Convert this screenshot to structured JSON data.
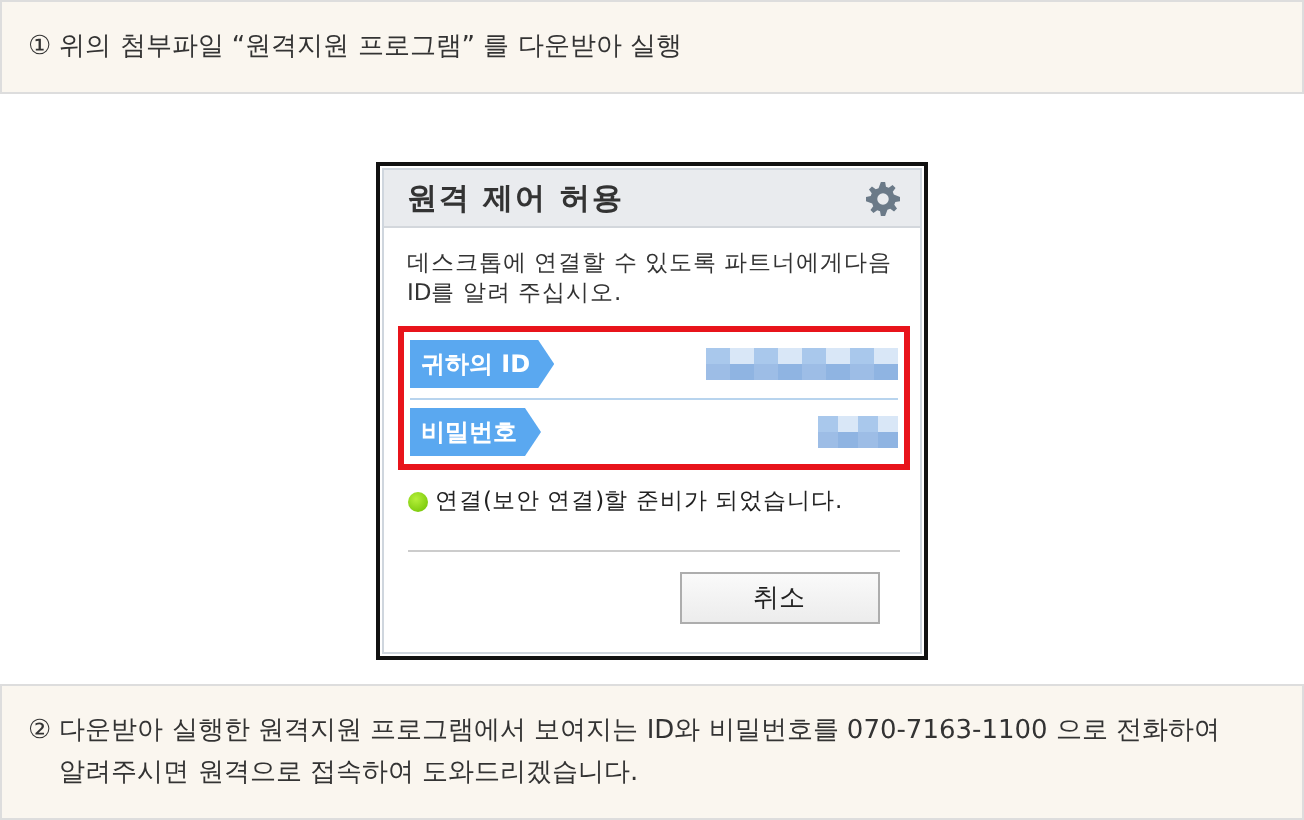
{
  "steps": [
    {
      "number": "①",
      "text": "위의 첨부파일 “원격지원 프로그램” 를 다운받아 실행"
    },
    {
      "number": "②",
      "text": "다운받아 실행한 원격지원 프로그램에서 보여지는 ID와  비밀번호를 070-7163-1100 으로 전화하여 알려주시면 원격으로 접속하여 도와드리겠습니다."
    }
  ],
  "dialog": {
    "title": "원격 제어 허용",
    "message": "데스크톱에 연결할 수 있도록 파트너에게다음 ID를 알려 주십시오.",
    "fields_highlighted": true,
    "fields": [
      {
        "label": "귀하의 ID"
      },
      {
        "label": "비밀번호"
      }
    ],
    "status": {
      "text": "연결(보안 연결)할 준비가 되었습니다.",
      "ready": true
    },
    "buttons": [
      "취소"
    ]
  }
}
